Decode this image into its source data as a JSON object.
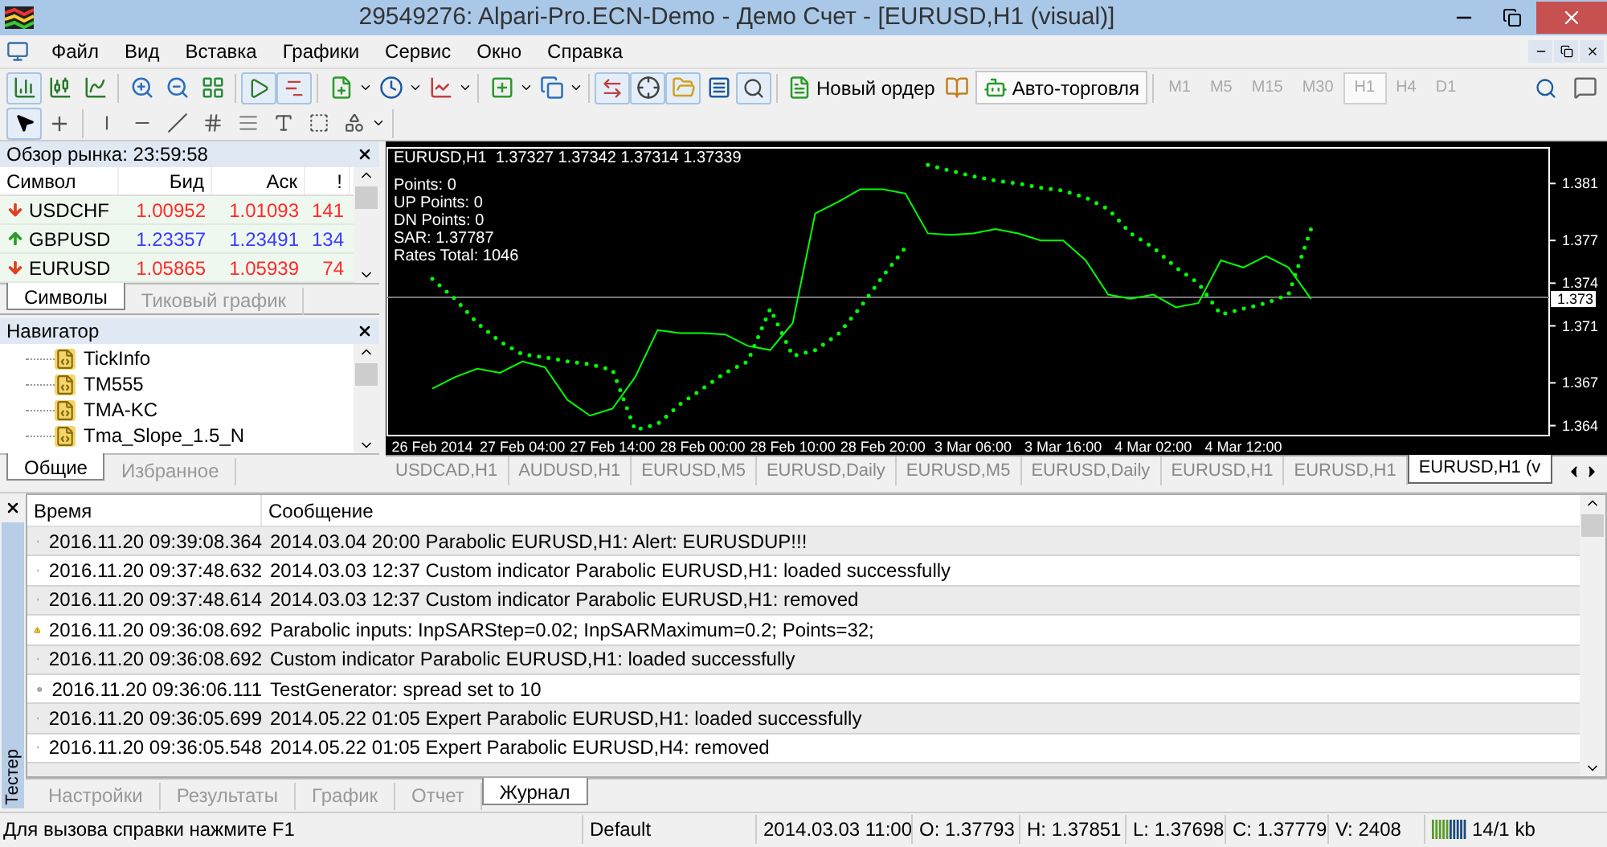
{
  "window": {
    "title": "29549276: Alpari-Pro.ECN-Demo - Демо Счет - [EURUSD,H1 (visual)]"
  },
  "menu": [
    "Файл",
    "Вид",
    "Вставка",
    "Графики",
    "Сервис",
    "Окно",
    "Справка"
  ],
  "toolbar": {
    "new_order": "Новый ордер",
    "auto_trading": {
      "label": "Авто-торговля",
      "pressed": true
    },
    "timeframes": [
      {
        "label": "M1",
        "selected": false,
        "disabled": true
      },
      {
        "label": "M5",
        "selected": false,
        "disabled": true
      },
      {
        "label": "M15",
        "selected": false,
        "disabled": true
      },
      {
        "label": "M30",
        "selected": false,
        "disabled": true
      },
      {
        "label": "H1",
        "selected": true,
        "disabled": true
      },
      {
        "label": "H4",
        "selected": false,
        "disabled": true
      },
      {
        "label": "D1",
        "selected": false,
        "disabled": true
      }
    ]
  },
  "market_watch": {
    "title": "Обзор рынка: 23:59:58",
    "columns": [
      "Символ",
      "Бид",
      "Аск",
      "!"
    ],
    "rows": [
      {
        "symbol": "USDCHF",
        "bid": "1.00952",
        "ask": "1.01093",
        "spread": "141",
        "rising": false
      },
      {
        "symbol": "GBPUSD",
        "bid": "1.23357",
        "ask": "1.23491",
        "spread": "134",
        "rising": true
      },
      {
        "symbol": "EURUSD",
        "bid": "1.05865",
        "ask": "1.05939",
        "spread": "74",
        "rising": false
      }
    ],
    "tabs": [
      {
        "label": "Символы",
        "selected": true
      },
      {
        "label": "Тиковый график",
        "selected": false
      }
    ]
  },
  "navigator": {
    "title": "Навигатор",
    "items": [
      "TickInfo",
      "TM555",
      "TMA-KC",
      "Tma_Slope_1.5_N"
    ],
    "tabs": [
      {
        "label": "Общие",
        "selected": true
      },
      {
        "label": "Избранное",
        "selected": false
      }
    ]
  },
  "chart": {
    "header": "EURUSD,H1  1.37327 1.37342 1.37314 1.37339",
    "info": [
      "Points: 0",
      "UP Points: 0",
      "DN Points: 0",
      "SAR: 1.37787",
      "Rates Total: 1046"
    ],
    "chart_data": {
      "type": "line",
      "categories": [
        "26 Feb 2014",
        null,
        null,
        null,
        "27 Feb 04:00",
        null,
        null,
        null,
        "27 Feb 14:00",
        null,
        null,
        null,
        "28 Feb 00:00",
        null,
        null,
        null,
        "28 Feb 10:00",
        null,
        null,
        null,
        "28 Feb 20:00",
        null,
        null,
        null,
        "3 Mar 06:00",
        null,
        null,
        null,
        "3 Mar 16:00",
        null,
        null,
        null,
        "4 Mar 02:00",
        null,
        null,
        null,
        "4 Mar 12:00",
        null,
        null,
        null,
        null,
        null,
        null,
        null,
        null,
        null,
        null,
        null,
        null,
        null
      ],
      "ylim": [
        1.3633,
        1.3835
      ],
      "ref_lines": [
        {
          "axis": "y",
          "value": 1.373,
          "label": "1.373",
          "color": "#777777"
        }
      ],
      "yticks": [
        1.364,
        1.367,
        1.371,
        1.374,
        1.377,
        1.381
      ],
      "series": [
        {
          "color": "#00ff00",
          "line_style": "solid",
          "values": [
            1.3666,
            1.3674,
            1.368,
            1.3677,
            1.3685,
            1.3681,
            1.3658,
            1.3647,
            1.3652,
            1.3674,
            1.3707,
            1.3705,
            1.3705,
            1.3704,
            1.3696,
            1.3693,
            1.3712,
            1.3789,
            1.3797,
            1.3806,
            1.3806,
            1.3803,
            1.3775,
            1.3774,
            1.3775,
            1.3778,
            1.3775,
            1.377,
            1.377,
            1.3756,
            1.3732,
            1.3729,
            1.3732,
            1.3723,
            1.3726,
            1.3756,
            1.3751,
            1.3759,
            1.3751,
            1.3729,
            null,
            null,
            null,
            null,
            null,
            null,
            null,
            null,
            null,
            null
          ]
        },
        {
          "color": "#00ff00",
          "line_style": "dotted",
          "values": [
            1.3743,
            1.3729,
            1.3712,
            1.3699,
            1.369,
            1.3688,
            1.3685,
            1.3683,
            1.3679,
            1.3637,
            1.3641,
            1.3655,
            1.3666,
            1.3677,
            1.3685,
            1.3722,
            1.3689,
            1.3693,
            1.3704,
            1.3723,
            1.3745,
            1.3765,
            1.3823,
            1.3819,
            1.3815,
            1.3812,
            1.381,
            1.3807,
            1.3805,
            1.38,
            1.3792,
            1.3775,
            1.3765,
            1.3751,
            1.374,
            1.3718,
            1.3722,
            1.3726,
            1.3732,
            1.3778,
            null,
            null,
            null,
            null,
            null,
            null,
            null,
            null,
            null,
            null
          ]
        }
      ]
    }
  },
  "chart_tabs": [
    {
      "label": "USDCAD,H1",
      "selected": false
    },
    {
      "label": "AUDUSD,H1",
      "selected": false
    },
    {
      "label": "EURUSD,M5",
      "selected": false
    },
    {
      "label": "EURUSD,Daily",
      "selected": false
    },
    {
      "label": "EURUSD,M5",
      "selected": false
    },
    {
      "label": "EURUSD,Daily",
      "selected": false
    },
    {
      "label": "EURUSD,H1",
      "selected": false
    },
    {
      "label": "EURUSD,H1",
      "selected": false
    },
    {
      "label": "EURUSD,H1 (v",
      "selected": true
    }
  ],
  "terminal": {
    "side_label": "Тестер",
    "columns": [
      "Время",
      "Сообщение"
    ],
    "rows": [
      {
        "kind": "info",
        "time": "2016.11.20 09:39:08.364",
        "message": "2014.03.04 20:00  Parabolic EURUSD,H1: Alert: EURUSDUP!!!"
      },
      {
        "kind": "info",
        "time": "2016.11.20 09:37:48.632",
        "message": "2014.03.03 12:37  Custom indicator Parabolic EURUSD,H1: loaded successfully"
      },
      {
        "kind": "info",
        "time": "2016.11.20 09:37:48.614",
        "message": "2014.03.03 12:37  Custom indicator Parabolic EURUSD,H1: removed"
      },
      {
        "kind": "warning",
        "time": "2016.11.20 09:36:08.692",
        "message": "Parabolic inputs: InpSARStep=0.02; InpSARMaximum=0.2; Points=32;"
      },
      {
        "kind": "info",
        "time": "2016.11.20 09:36:08.692",
        "message": "Custom indicator Parabolic EURUSD,H1: loaded successfully"
      },
      {
        "kind": "info",
        "time": "2016.11.20 09:36:06.111",
        "message": "TestGenerator: spread set to 10"
      },
      {
        "kind": "info",
        "time": "2016.11.20 09:36:05.699",
        "message": "2014.05.22 01:05  Expert Parabolic EURUSD,H1: loaded successfully"
      },
      {
        "kind": "info",
        "time": "2016.11.20 09:36:05.548",
        "message": "2014.05.22 01:05  Expert Parabolic EURUSD,H4: removed"
      }
    ],
    "tabs": [
      {
        "label": "Настройки",
        "selected": false
      },
      {
        "label": "Результаты",
        "selected": false
      },
      {
        "label": "График",
        "selected": false
      },
      {
        "label": "Отчет",
        "selected": false
      },
      {
        "label": "Журнал",
        "selected": true
      }
    ]
  },
  "status_bar": [
    "Для вызова справки нажмите F1",
    "Default",
    "2014.03.03 11:00",
    "O: 1.37793",
    "H: 1.37851",
    "L: 1.37698",
    "C: 1.37779",
    "V: 2408",
    "14/1 kb"
  ]
}
